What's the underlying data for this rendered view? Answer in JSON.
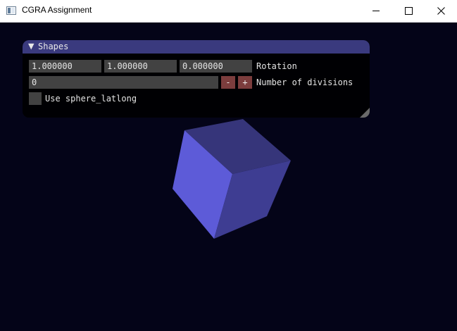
{
  "window": {
    "title": "CGRA Assignment",
    "icon": "app-window-icon",
    "controls": [
      "minimize-icon",
      "maximize-icon",
      "close-icon"
    ]
  },
  "panel": {
    "title": "Shapes",
    "collapse_icon": "▼",
    "rotation": {
      "values": [
        "1.000000",
        "1.000000",
        "0.000000"
      ],
      "label": "Rotation"
    },
    "divisions": {
      "value": "0",
      "decrement_label": "-",
      "increment_label": "+",
      "label": "Number of divisions"
    },
    "sphere": {
      "checked": false,
      "label": "Use sphere_latlong"
    }
  },
  "colors": {
    "viewport_background": "#040418",
    "panel_header": "#3a3a7e",
    "field_background": "#424242",
    "step_button": "#7c3d3d",
    "cube_front": "#5d5bd8",
    "cube_top": "#36357a",
    "cube_right": "#3e3d92"
  }
}
